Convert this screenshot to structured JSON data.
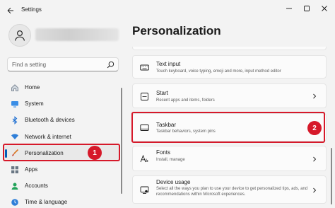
{
  "window": {
    "title": "Settings"
  },
  "search": {
    "placeholder": "Find a setting"
  },
  "nav": {
    "items": [
      {
        "label": "Home"
      },
      {
        "label": "System"
      },
      {
        "label": "Bluetooth & devices"
      },
      {
        "label": "Network & internet"
      },
      {
        "label": "Personalization",
        "active": true
      },
      {
        "label": "Apps"
      },
      {
        "label": "Accounts"
      },
      {
        "label": "Time & language"
      }
    ]
  },
  "main": {
    "title": "Personalization",
    "cards": [
      {
        "title": "Text input",
        "subtitle": "Touch keyboard, voice typing, emoji and more, input method editor"
      },
      {
        "title": "Start",
        "subtitle": "Recent apps and items, folders"
      },
      {
        "title": "Taskbar",
        "subtitle": "Taskbar behaviors, system pins"
      },
      {
        "title": "Fonts",
        "subtitle": "Install, manage"
      },
      {
        "title": "Device usage",
        "subtitle": "Select all the ways you plan to use your device to get personalized tips, ads, and recommendations within Microsoft experiences."
      }
    ]
  },
  "annotations": {
    "step1": "1",
    "step2": "2"
  },
  "colors": {
    "accent": "#005fb8",
    "highlight": "#d6192a"
  }
}
